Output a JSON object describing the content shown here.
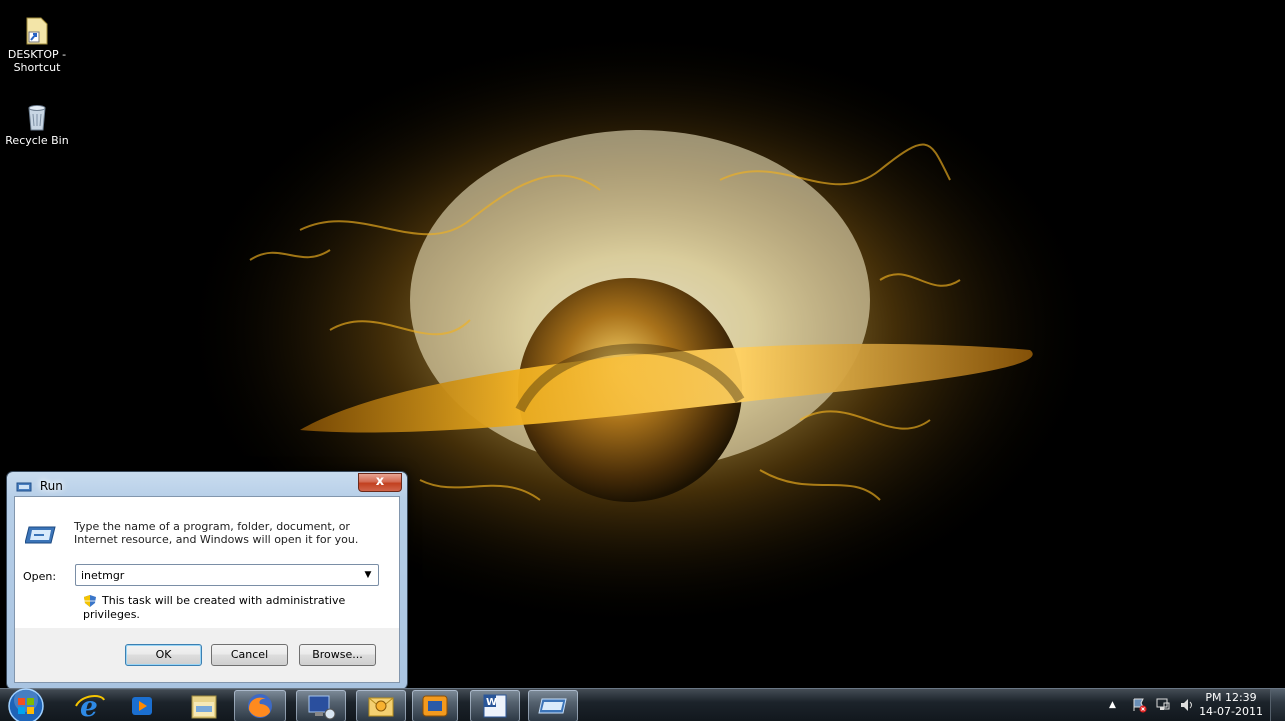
{
  "desktop": {
    "icons": [
      {
        "label": "DESKTOP - Shortcut",
        "icon": "folder-shortcut-icon"
      },
      {
        "label": "Recycle Bin",
        "icon": "recycle-bin-icon"
      }
    ]
  },
  "run_dialog": {
    "title": "Run",
    "close_label": "x",
    "description": "Type the name of a program, folder, document, or Internet resource, and Windows will open it for you.",
    "open_label": "Open:",
    "open_value": "inetmgr",
    "admin_note": "This task will be created with administrative privileges.",
    "ok_label": "OK",
    "cancel_label": "Cancel",
    "browse_label": "Browse..."
  },
  "taskbar": {
    "items": [
      {
        "name": "start-button",
        "icon": "windows-orb-icon"
      },
      {
        "name": "internet-explorer",
        "icon": "internet-explorer-icon"
      },
      {
        "name": "media-player",
        "icon": "media-player-icon"
      },
      {
        "name": "file-explorer",
        "icon": "explorer-icon"
      },
      {
        "name": "firefox",
        "icon": "firefox-icon"
      },
      {
        "name": "network-app",
        "icon": "network-icon"
      },
      {
        "name": "outlook",
        "icon": "outlook-icon"
      },
      {
        "name": "orange-app",
        "icon": "orange-window-icon"
      },
      {
        "name": "word",
        "icon": "word-icon"
      },
      {
        "name": "run-window",
        "icon": "run-icon"
      }
    ],
    "clock": {
      "time": "PM 12:39",
      "date": "14-07-2011"
    },
    "tray_icons": [
      "show-hidden-icons",
      "action-center-icon",
      "network-tray-icon",
      "volume-icon"
    ]
  },
  "colors": {
    "taskbar": "#1f2830",
    "dialog_frame": "#b7cfe8",
    "close_button": "#c2401f",
    "wallpaper_glow": "#f7c23a"
  }
}
